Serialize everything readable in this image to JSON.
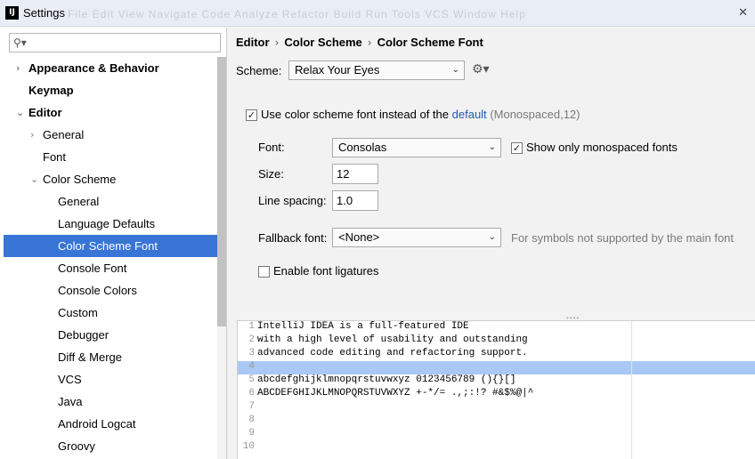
{
  "window": {
    "title": "Settings",
    "app_icon": "IJ",
    "ghost_menu": "File  Edit  View  Navigate  Code  Analyze  Refactor  Build  Run  Tools  VCS  Window  Help"
  },
  "sidebar": {
    "search_placeholder": "",
    "items": [
      {
        "label": "Appearance & Behavior",
        "level": 0,
        "arrow": "›",
        "bold": true
      },
      {
        "label": "Keymap",
        "level": 0,
        "arrow": "",
        "bold": true
      },
      {
        "label": "Editor",
        "level": 0,
        "arrow": "⌄",
        "bold": true
      },
      {
        "label": "General",
        "level": 1,
        "arrow": "›"
      },
      {
        "label": "Font",
        "level": 1,
        "arrow": ""
      },
      {
        "label": "Color Scheme",
        "level": 1,
        "arrow": "⌄"
      },
      {
        "label": "General",
        "level": 2,
        "arrow": ""
      },
      {
        "label": "Language Defaults",
        "level": 2,
        "arrow": ""
      },
      {
        "label": "Color Scheme Font",
        "level": 2,
        "arrow": "",
        "selected": true
      },
      {
        "label": "Console Font",
        "level": 2,
        "arrow": ""
      },
      {
        "label": "Console Colors",
        "level": 2,
        "arrow": ""
      },
      {
        "label": "Custom",
        "level": 2,
        "arrow": ""
      },
      {
        "label": "Debugger",
        "level": 2,
        "arrow": ""
      },
      {
        "label": "Diff & Merge",
        "level": 2,
        "arrow": ""
      },
      {
        "label": "VCS",
        "level": 2,
        "arrow": ""
      },
      {
        "label": "Java",
        "level": 2,
        "arrow": ""
      },
      {
        "label": "Android Logcat",
        "level": 2,
        "arrow": ""
      },
      {
        "label": "Groovy",
        "level": 2,
        "arrow": ""
      }
    ]
  },
  "breadcrumb": [
    "Editor",
    "Color Scheme",
    "Color Scheme Font"
  ],
  "breadcrumb_sep": "›",
  "scheme": {
    "label": "Scheme:",
    "value": "Relax Your Eyes"
  },
  "use_scheme_font": {
    "checked": true,
    "mark": "✓",
    "label": "Use color scheme font instead of the",
    "link": "default",
    "suffix": "(Monospaced,12)"
  },
  "font": {
    "label": "Font:",
    "value": "Consolas"
  },
  "monospaced_only": {
    "checked": true,
    "mark": "✓",
    "label": "Show only monospaced fonts"
  },
  "size": {
    "label": "Size:",
    "value": "12"
  },
  "line_spacing": {
    "label": "Line spacing:",
    "value": "1.0"
  },
  "fallback": {
    "label": "Fallback font:",
    "value": "<None>",
    "hint": "For symbols not supported by the main font"
  },
  "ligatures": {
    "checked": false,
    "mark": "",
    "label": "Enable font ligatures"
  },
  "preview": {
    "lines": [
      {
        "n": "1",
        "text": "IntelliJ IDEA is a full-featured IDE"
      },
      {
        "n": "2",
        "text": "with a high level of usability and outstanding"
      },
      {
        "n": "3",
        "text": "advanced code editing and refactoring support."
      },
      {
        "n": "4",
        "text": ""
      },
      {
        "n": "5",
        "text": "abcdefghijklmnopqrstuvwxyz 0123456789 (){}[]"
      },
      {
        "n": "6",
        "text": "ABCDEFGHIJKLMNOPQRSTUVWXYZ +-*/= .,;:!? #&$%@|^"
      },
      {
        "n": "7",
        "text": ""
      },
      {
        "n": "8",
        "text": ""
      },
      {
        "n": "9",
        "text": ""
      },
      {
        "n": "10",
        "text": ""
      }
    ]
  },
  "colors": {
    "selection": "#3875d7",
    "highlight_line": "#a9c8f5",
    "link": "#2a55b8"
  }
}
